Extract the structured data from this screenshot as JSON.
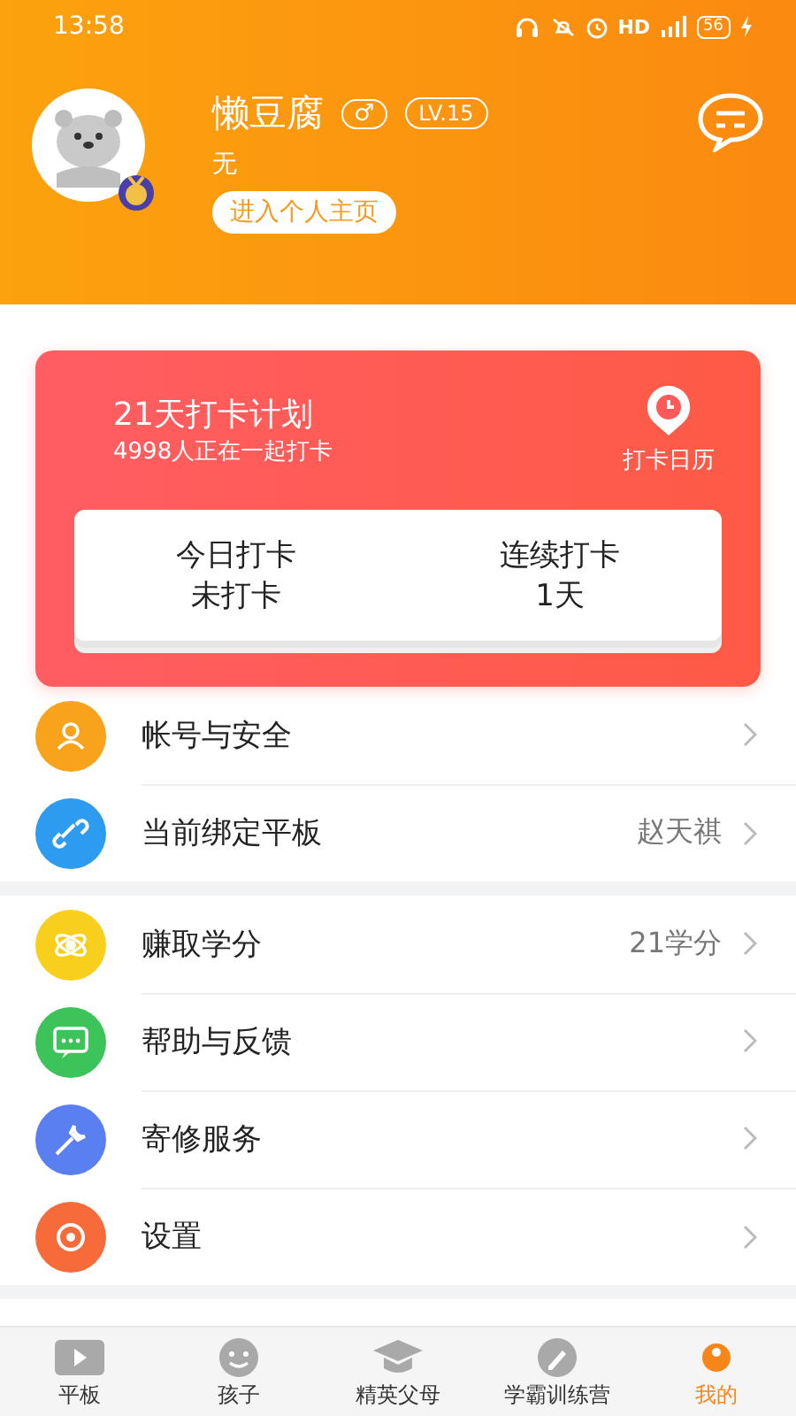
{
  "status_bar": {
    "time": "13:58",
    "network": "HD",
    "battery": "56"
  },
  "profile": {
    "name": "懒豆腐",
    "gender": "♂",
    "level_badge": "LV.15",
    "signature": "无",
    "homepage_button": "进入个人主页"
  },
  "checkin": {
    "title": "21天打卡计划",
    "subtitle": "4998人正在一起打卡",
    "calendar_label": "打卡日历",
    "stats": [
      {
        "label": "今日打卡",
        "value": "未打卡"
      },
      {
        "label": "连续打卡",
        "value": "1天"
      }
    ]
  },
  "menu_groups": [
    [
      {
        "kind": "user",
        "label": "帐号与安全",
        "color": "#f9a21b"
      },
      {
        "kind": "link",
        "label": "当前绑定平板",
        "value": "赵天祺",
        "color": "#2d9cf0"
      }
    ],
    [
      {
        "kind": "orbit",
        "label": "赚取学分",
        "value": "21学分",
        "color": "#f8cf1c"
      },
      {
        "kind": "chat",
        "label": "帮助与反馈",
        "color": "#3cc45a"
      },
      {
        "kind": "wrench",
        "label": "寄修服务",
        "color": "#5a7ff0"
      },
      {
        "kind": "gear",
        "label": "设置",
        "color": "#f76b3a"
      }
    ]
  ],
  "tabs": [
    {
      "kind": "tablet",
      "label": "平板",
      "selected": false
    },
    {
      "kind": "face",
      "label": "孩子",
      "selected": false
    },
    {
      "kind": "cap",
      "label": "精英父母",
      "selected": false
    },
    {
      "kind": "pen",
      "label": "学霸训练营",
      "selected": false
    },
    {
      "kind": "me",
      "label": "我的",
      "selected": true
    }
  ]
}
